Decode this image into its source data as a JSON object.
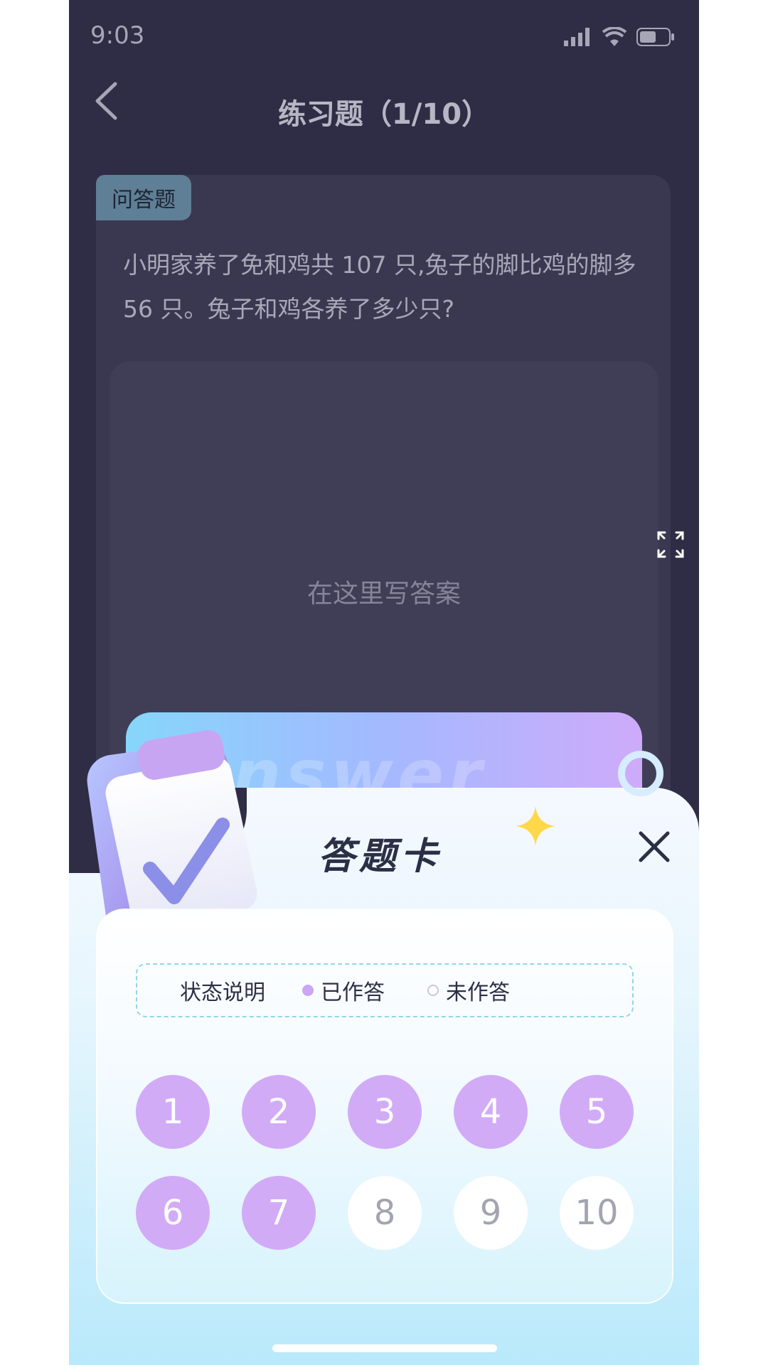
{
  "status_bar": {
    "time": "9:03"
  },
  "header": {
    "title": "练习题（1/10）"
  },
  "question": {
    "type_tag": "问答题",
    "text": "小明家养了免和鸡共 107 只,兔子的脚比鸡的脚多 56 只。兔子和鸡各养了多少只?",
    "answer_placeholder": "在这里写答案"
  },
  "answer_sheet": {
    "watermark": "nswer",
    "title": "答题卡",
    "legend": {
      "label": "状态说明",
      "answered": "已作答",
      "unanswered": "未作答"
    },
    "questions": [
      {
        "number": "1",
        "answered": true
      },
      {
        "number": "2",
        "answered": true
      },
      {
        "number": "3",
        "answered": true
      },
      {
        "number": "4",
        "answered": true
      },
      {
        "number": "5",
        "answered": true
      },
      {
        "number": "6",
        "answered": true
      },
      {
        "number": "7",
        "answered": true
      },
      {
        "number": "8",
        "answered": false
      },
      {
        "number": "9",
        "answered": false
      },
      {
        "number": "10",
        "answered": false
      }
    ]
  },
  "colors": {
    "answered": "#d2abf7",
    "unanswered": "#ffffff",
    "dark_bg": "#2f2d45"
  },
  "icons": [
    "back-icon",
    "signal-icon",
    "wifi-icon",
    "battery-icon",
    "expand-icon",
    "close-icon",
    "clipboard-icon",
    "sparkle-icon"
  ]
}
